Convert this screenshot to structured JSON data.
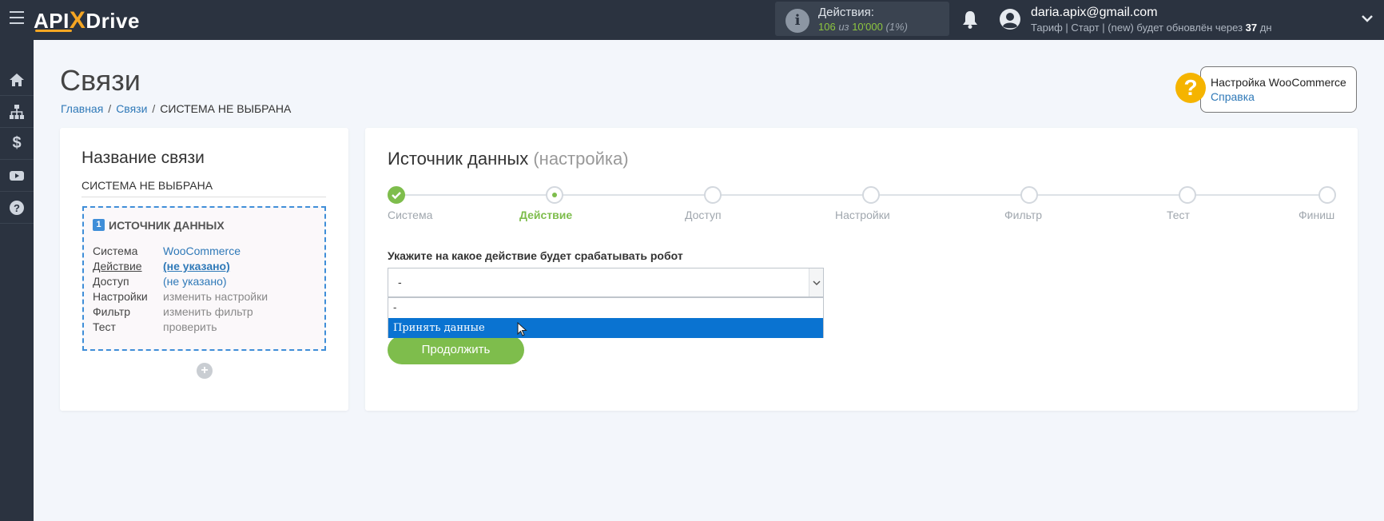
{
  "header": {
    "logo_left": "API",
    "logo_x": "X",
    "logo_right": "Drive",
    "actions_label": "Действия:",
    "actions_used": "106",
    "actions_sep": " из ",
    "actions_total": "10'000",
    "actions_percent": " (1%)",
    "user_email": "daria.apix@gmail.com",
    "tariff_text": "Тариф | Старт | (new) будет обновлён через ",
    "tariff_days": "37",
    "tariff_days_unit": " дн"
  },
  "sidebar": {
    "items": [
      "home-icon",
      "sitemap-icon",
      "dollar-icon",
      "youtube-icon",
      "help-icon"
    ],
    "dollar_glyph": "$"
  },
  "page": {
    "title": "Связи",
    "breadcrumb": {
      "home": "Главная",
      "connections": "Связи",
      "current": "СИСТЕМА НЕ ВЫБРАНА"
    }
  },
  "help": {
    "glyph": "?",
    "title": "Настройка WooCommerce",
    "link": "Справка"
  },
  "left_card": {
    "heading": "Название связи",
    "connection_name": "СИСТЕМА НЕ ВЫБРАНА",
    "source": {
      "number": "1",
      "title": "ИСТОЧНИК ДАННЫХ",
      "rows": [
        {
          "key": "Система",
          "value": "WooCommerce"
        },
        {
          "key": "Действие",
          "value": "(не указано)"
        },
        {
          "key": "Доступ",
          "value": "(не указано)"
        },
        {
          "key": "Настройки",
          "value": "изменить настройки"
        },
        {
          "key": "Фильтр",
          "value": "изменить фильтр"
        },
        {
          "key": "Тест",
          "value": "проверить"
        }
      ]
    },
    "add_glyph": "+"
  },
  "right_card": {
    "heading": "Источник данных",
    "heading_sub": "(настройка)",
    "steps": [
      "Система",
      "Действие",
      "Доступ",
      "Настройки",
      "Фильтр",
      "Тест",
      "Финиш"
    ],
    "prompt": "Укажите на какое действие будет срабатывать робот",
    "select_value": "-",
    "options": [
      "-",
      "Принять данные"
    ],
    "continue_label": "Продолжить"
  },
  "colors": {
    "topbar": "#2b3340",
    "accent_green": "#7ebd4c",
    "link_blue": "#2f79b8",
    "highlight_blue": "#0a73d1",
    "logo_orange": "#f5a623",
    "help_yellow": "#f5b400"
  }
}
